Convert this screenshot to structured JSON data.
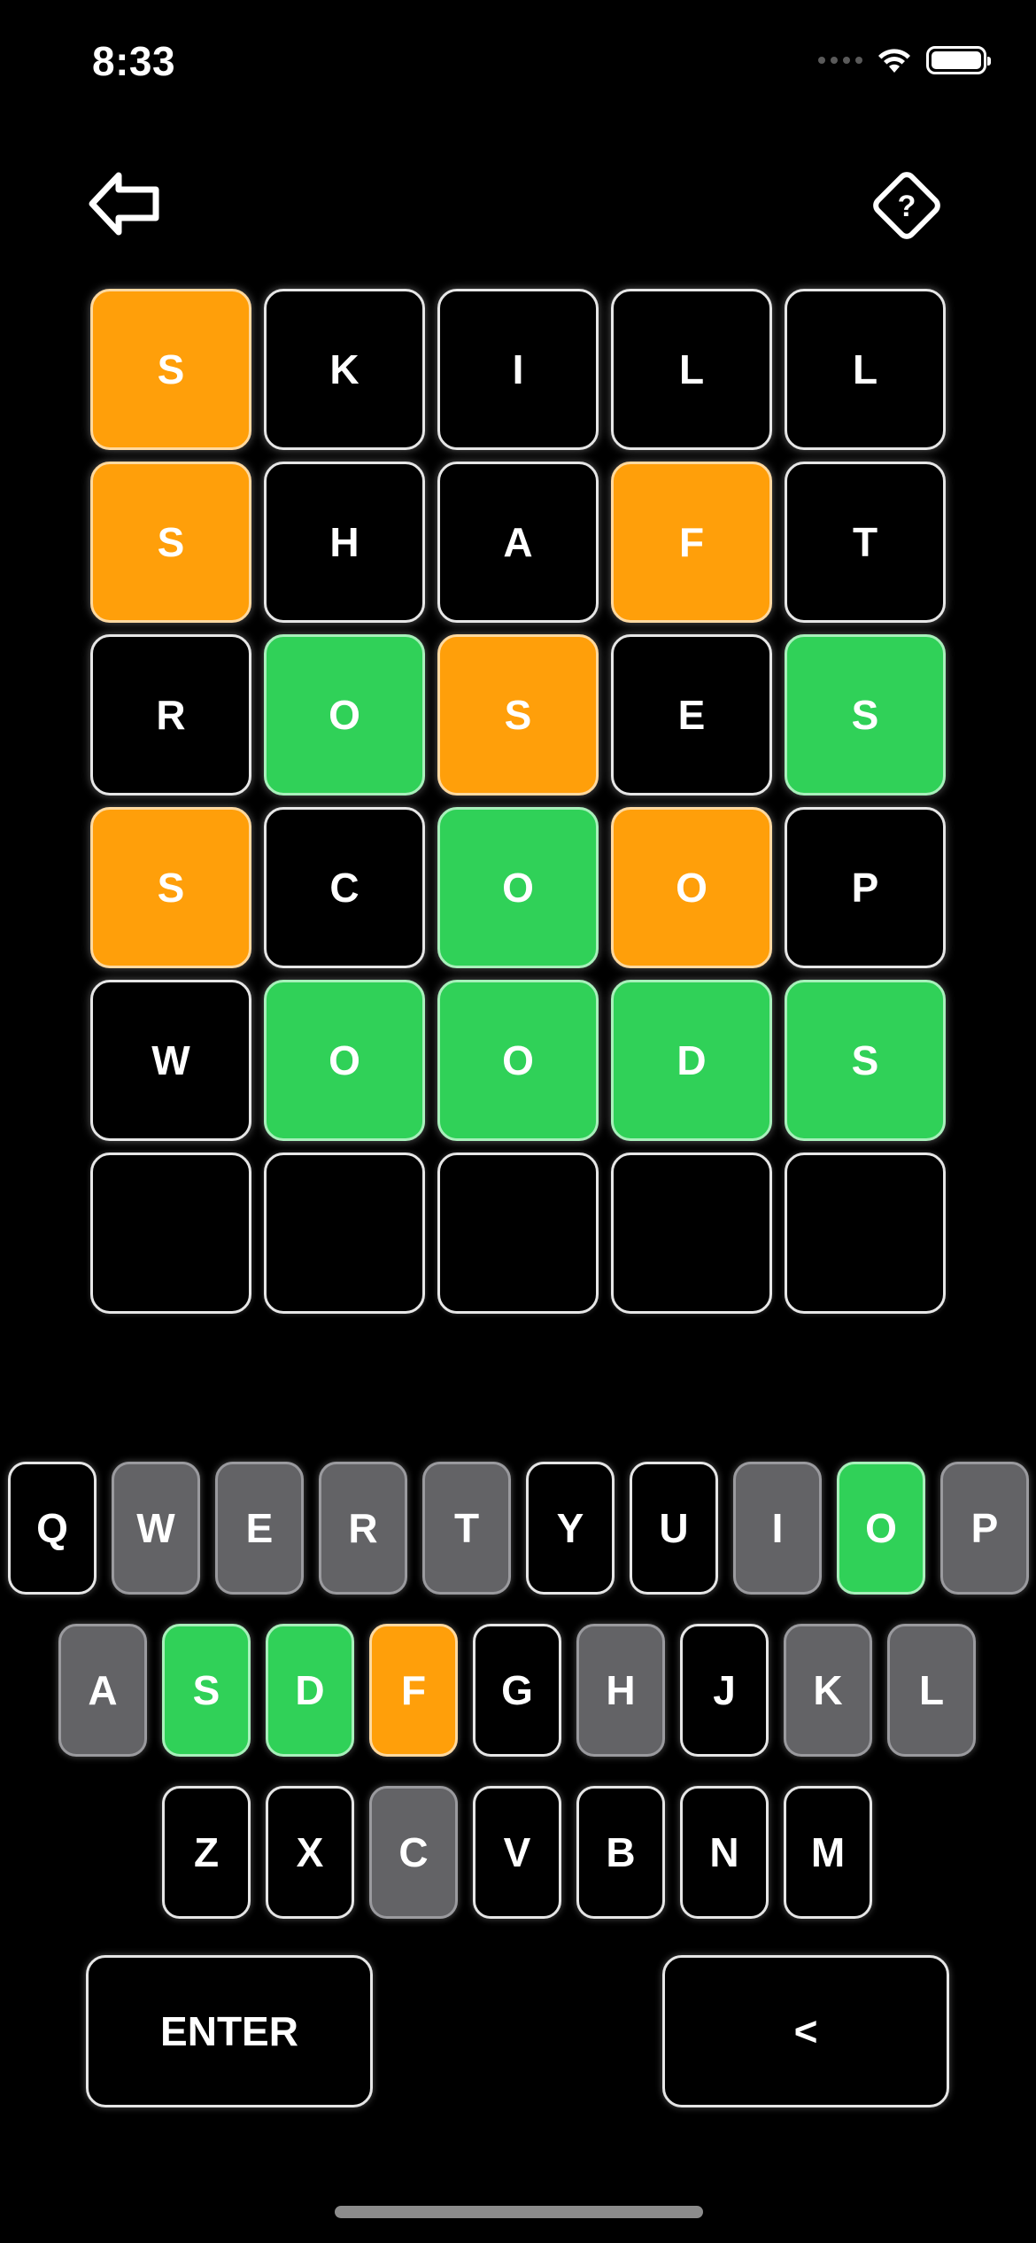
{
  "status_bar": {
    "time": "8:33",
    "wifi_icon": "wifi-icon",
    "battery_icon": "battery-icon"
  },
  "header": {
    "back_icon": "back-arrow-icon",
    "help_icon": "help-diamond-icon"
  },
  "colors": {
    "background": "#000000",
    "correct": "#30d158",
    "present": "#ff9f0a",
    "absent": "#636366",
    "border": "#e6e6e6"
  },
  "board": {
    "rows": [
      [
        {
          "letter": "S",
          "state": "present"
        },
        {
          "letter": "K",
          "state": "absent"
        },
        {
          "letter": "I",
          "state": "absent"
        },
        {
          "letter": "L",
          "state": "absent"
        },
        {
          "letter": "L",
          "state": "absent"
        }
      ],
      [
        {
          "letter": "S",
          "state": "present"
        },
        {
          "letter": "H",
          "state": "absent"
        },
        {
          "letter": "A",
          "state": "absent"
        },
        {
          "letter": "F",
          "state": "present"
        },
        {
          "letter": "T",
          "state": "absent"
        }
      ],
      [
        {
          "letter": "R",
          "state": "absent"
        },
        {
          "letter": "O",
          "state": "correct"
        },
        {
          "letter": "S",
          "state": "present"
        },
        {
          "letter": "E",
          "state": "absent"
        },
        {
          "letter": "S",
          "state": "correct"
        }
      ],
      [
        {
          "letter": "S",
          "state": "present"
        },
        {
          "letter": "C",
          "state": "absent"
        },
        {
          "letter": "O",
          "state": "correct"
        },
        {
          "letter": "O",
          "state": "present"
        },
        {
          "letter": "P",
          "state": "absent"
        }
      ],
      [
        {
          "letter": "W",
          "state": "absent"
        },
        {
          "letter": "O",
          "state": "correct"
        },
        {
          "letter": "O",
          "state": "correct"
        },
        {
          "letter": "D",
          "state": "correct"
        },
        {
          "letter": "S",
          "state": "correct"
        }
      ],
      [
        {
          "letter": "",
          "state": "empty"
        },
        {
          "letter": "",
          "state": "empty"
        },
        {
          "letter": "",
          "state": "empty"
        },
        {
          "letter": "",
          "state": "empty"
        },
        {
          "letter": "",
          "state": "empty"
        }
      ]
    ]
  },
  "keyboard": {
    "row1": [
      {
        "label": "Q",
        "state": "unused"
      },
      {
        "label": "W",
        "state": "absent"
      },
      {
        "label": "E",
        "state": "absent"
      },
      {
        "label": "R",
        "state": "absent"
      },
      {
        "label": "T",
        "state": "absent"
      },
      {
        "label": "Y",
        "state": "unused"
      },
      {
        "label": "U",
        "state": "unused"
      },
      {
        "label": "I",
        "state": "absent"
      },
      {
        "label": "O",
        "state": "correct"
      },
      {
        "label": "P",
        "state": "absent"
      }
    ],
    "row2": [
      {
        "label": "A",
        "state": "absent"
      },
      {
        "label": "S",
        "state": "correct"
      },
      {
        "label": "D",
        "state": "correct"
      },
      {
        "label": "F",
        "state": "present"
      },
      {
        "label": "G",
        "state": "unused"
      },
      {
        "label": "H",
        "state": "absent"
      },
      {
        "label": "J",
        "state": "unused"
      },
      {
        "label": "K",
        "state": "absent"
      },
      {
        "label": "L",
        "state": "absent"
      }
    ],
    "row3": [
      {
        "label": "Z",
        "state": "unused"
      },
      {
        "label": "X",
        "state": "unused"
      },
      {
        "label": "C",
        "state": "absent"
      },
      {
        "label": "V",
        "state": "unused"
      },
      {
        "label": "B",
        "state": "unused"
      },
      {
        "label": "N",
        "state": "unused"
      },
      {
        "label": "M",
        "state": "unused"
      }
    ],
    "enter_label": "ENTER",
    "backspace_label": "<"
  }
}
